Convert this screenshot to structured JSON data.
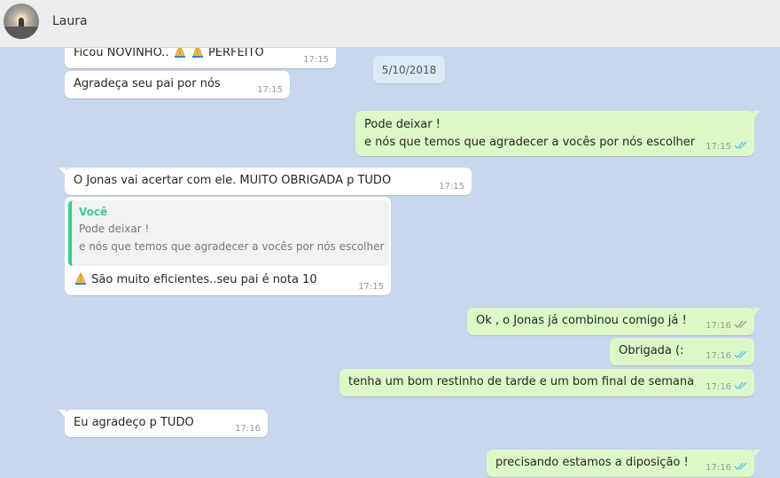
{
  "header": {
    "contact_name": "Laura"
  },
  "date_chip": "5/10/2018",
  "messages": {
    "m1": {
      "text_a": "Ficou NOVINHO..",
      "text_b": "PERFEITO",
      "time": "17:15"
    },
    "m2": {
      "text": "Agradeça seu pai por nós",
      "time": "17:15"
    },
    "m3": {
      "line1": "Pode deixar !",
      "line2": "e nós que temos que agradecer a vocês por nós escolher",
      "time": "17:15"
    },
    "m4": {
      "text": "O Jonas  vai  acertar com ele. MUITO  OBRIGADA  p TUDO",
      "time": "17:15"
    },
    "m5": {
      "quote_author": "Você",
      "quote_line1": "Pode deixar !",
      "quote_line2": "e nós que temos que agradecer a vocês por nós escolher",
      "text": "São  muito  eficientes..seu pai é  nota 10",
      "time": "17:15"
    },
    "m6": {
      "text": "Ok , o Jonas já combinou comigo já !",
      "time": "17:16"
    },
    "m7": {
      "text": "Obrigada (:",
      "time": "17:16"
    },
    "m8": {
      "text": "tenha um bom restinho de tarde e um bom final de semana",
      "time": "17:16"
    },
    "m9": {
      "text": "Eu agradeço  p TUDO",
      "time": "17:16"
    },
    "m10": {
      "text": "precisando estamos a diposição !",
      "time": "17:16"
    }
  },
  "colors": {
    "chat_background": "#c7d7ec",
    "incoming_bubble": "#ffffff",
    "outgoing_bubble": "#dcf8c6",
    "read_ticks": "#4fc3f7",
    "delivered_ticks": "#999999",
    "quote_accent": "#35cd96"
  },
  "icons": [
    "praying-hands-emoji",
    "double-check-read-icon",
    "double-check-delivered-icon"
  ]
}
